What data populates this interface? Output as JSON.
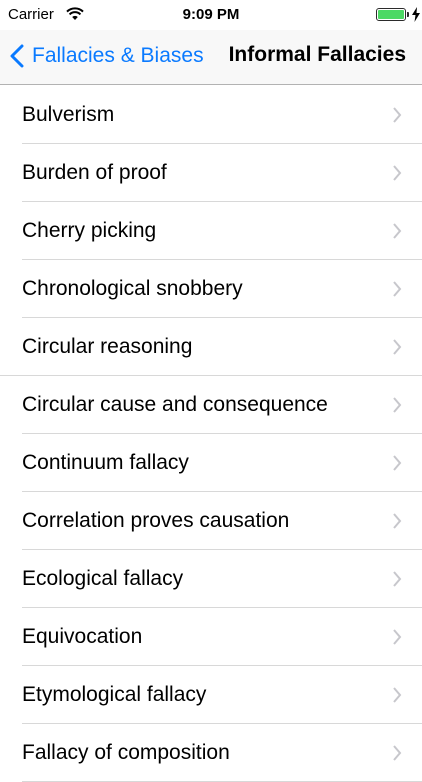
{
  "status_bar": {
    "carrier": "Carrier",
    "time": "9:09 PM",
    "battery_level": 1.0,
    "battery_color": "#4cd964",
    "icons": [
      "wifi-icon",
      "battery-icon",
      "charging-bolt-icon"
    ]
  },
  "nav": {
    "back_label": "Fallacies & Biases",
    "title": "Informal Fallacies",
    "accent_color": "#0a7aff"
  },
  "list": {
    "items": [
      {
        "label": "Bulverism"
      },
      {
        "label": "Burden of proof"
      },
      {
        "label": "Cherry picking"
      },
      {
        "label": "Chronological snobbery"
      },
      {
        "label": "Circular reasoning"
      },
      {
        "label": "Circular cause and consequence"
      },
      {
        "label": "Continuum fallacy"
      },
      {
        "label": "Correlation proves causation"
      },
      {
        "label": "Ecological fallacy"
      },
      {
        "label": "Equivocation"
      },
      {
        "label": "Etymological fallacy"
      },
      {
        "label": "Fallacy of composition"
      }
    ]
  }
}
